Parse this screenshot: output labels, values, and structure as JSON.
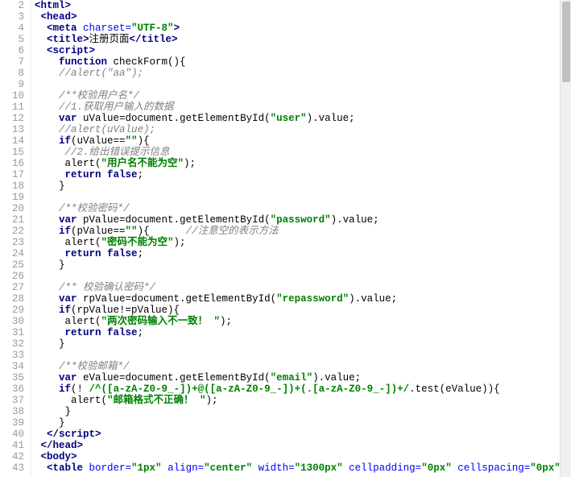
{
  "gutter_start": 2,
  "gutter_end": 43,
  "lines": [
    [
      [
        "tag",
        "<html>"
      ]
    ],
    [
      [
        "plain",
        " "
      ],
      [
        "tag",
        "<head>"
      ]
    ],
    [
      [
        "plain",
        "  "
      ],
      [
        "tag",
        "<meta "
      ],
      [
        "attr",
        "charset="
      ],
      [
        "attrval",
        "\"UTF-8\""
      ],
      [
        "tag",
        ">"
      ]
    ],
    [
      [
        "plain",
        "  "
      ],
      [
        "tag",
        "<title>"
      ],
      [
        "plain",
        "注册页面"
      ],
      [
        "tag",
        "</title>"
      ]
    ],
    [
      [
        "plain",
        "  "
      ],
      [
        "tag",
        "<script>"
      ]
    ],
    [
      [
        "plain",
        "    "
      ],
      [
        "keyword",
        "function"
      ],
      [
        "plain",
        " checkForm(){"
      ]
    ],
    [
      [
        "plain",
        "    "
      ],
      [
        "comment",
        "//alert(\"aa\");"
      ]
    ],
    [
      [
        "plain",
        ""
      ]
    ],
    [
      [
        "plain",
        "    "
      ],
      [
        "comment",
        "/**校验用户名*/"
      ]
    ],
    [
      [
        "plain",
        "    "
      ],
      [
        "comment",
        "//1.获取用户输入的数据"
      ]
    ],
    [
      [
        "plain",
        "    "
      ],
      [
        "keyword",
        "var"
      ],
      [
        "plain",
        " uValue=document.getElementById("
      ],
      [
        "string",
        "\"user\""
      ],
      [
        "plain",
        ").value;"
      ]
    ],
    [
      [
        "plain",
        "    "
      ],
      [
        "comment",
        "//alert(uValue);"
      ]
    ],
    [
      [
        "plain",
        "    "
      ],
      [
        "keyword",
        "if"
      ],
      [
        "plain",
        "(uValue=="
      ],
      [
        "string",
        "\"\""
      ],
      [
        "plain",
        "){"
      ]
    ],
    [
      [
        "plain",
        "     "
      ],
      [
        "comment",
        "//2.给出错误提示信息"
      ]
    ],
    [
      [
        "plain",
        "     alert("
      ],
      [
        "string",
        "\"用户名不能为空\""
      ],
      [
        "plain",
        ");"
      ]
    ],
    [
      [
        "plain",
        "     "
      ],
      [
        "keyword",
        "return"
      ],
      [
        "plain",
        " "
      ],
      [
        "keyword",
        "false"
      ],
      [
        "plain",
        ";"
      ]
    ],
    [
      [
        "plain",
        "    }"
      ]
    ],
    [
      [
        "plain",
        ""
      ]
    ],
    [
      [
        "plain",
        "    "
      ],
      [
        "comment",
        "/**校验密码*/"
      ]
    ],
    [
      [
        "plain",
        "    "
      ],
      [
        "keyword",
        "var"
      ],
      [
        "plain",
        " pValue=document.getElementById("
      ],
      [
        "string",
        "\"password\""
      ],
      [
        "plain",
        ").value;"
      ]
    ],
    [
      [
        "plain",
        "    "
      ],
      [
        "keyword",
        "if"
      ],
      [
        "plain",
        "(pValue=="
      ],
      [
        "string",
        "\"\""
      ],
      [
        "plain",
        "){      "
      ],
      [
        "comment",
        "//注意空的表示方法"
      ]
    ],
    [
      [
        "plain",
        "     alert("
      ],
      [
        "string",
        "\"密码不能为空\""
      ],
      [
        "plain",
        ");"
      ]
    ],
    [
      [
        "plain",
        "     "
      ],
      [
        "keyword",
        "return"
      ],
      [
        "plain",
        " "
      ],
      [
        "keyword",
        "false"
      ],
      [
        "plain",
        ";"
      ]
    ],
    [
      [
        "plain",
        "    }"
      ]
    ],
    [
      [
        "plain",
        ""
      ]
    ],
    [
      [
        "plain",
        "    "
      ],
      [
        "comment",
        "/** 校验确认密码*/"
      ]
    ],
    [
      [
        "plain",
        "    "
      ],
      [
        "keyword",
        "var"
      ],
      [
        "plain",
        " rpValue=document.getElementById("
      ],
      [
        "string",
        "\"repassword\""
      ],
      [
        "plain",
        ").value;"
      ]
    ],
    [
      [
        "plain",
        "    "
      ],
      [
        "keyword",
        "if"
      ],
      [
        "plain",
        "(rpValue!=pValue){"
      ]
    ],
    [
      [
        "plain",
        "     alert("
      ],
      [
        "string",
        "\"两次密码输入不一致！ \""
      ],
      [
        "plain",
        ");"
      ]
    ],
    [
      [
        "plain",
        "     "
      ],
      [
        "keyword",
        "return"
      ],
      [
        "plain",
        " "
      ],
      [
        "keyword",
        "false"
      ],
      [
        "plain",
        ";"
      ]
    ],
    [
      [
        "plain",
        "    }"
      ]
    ],
    [
      [
        "plain",
        ""
      ]
    ],
    [
      [
        "plain",
        "    "
      ],
      [
        "comment",
        "/**校验邮箱*/"
      ]
    ],
    [
      [
        "plain",
        "    "
      ],
      [
        "keyword",
        "var"
      ],
      [
        "plain",
        " eValue=document.getElementById("
      ],
      [
        "string",
        "\"email\""
      ],
      [
        "plain",
        ").value;"
      ]
    ],
    [
      [
        "plain",
        "    "
      ],
      [
        "keyword",
        "if"
      ],
      [
        "plain",
        "(! "
      ],
      [
        "string",
        "/^([a-zA-Z0-9_-])+@([a-zA-Z0-9_-])+(.[a-zA-Z0-9_-])+/"
      ],
      [
        "plain",
        ".test(eValue)){"
      ]
    ],
    [
      [
        "plain",
        "      alert("
      ],
      [
        "string",
        "\"邮箱格式不正确！ \""
      ],
      [
        "plain",
        ");"
      ]
    ],
    [
      [
        "plain",
        "     }"
      ]
    ],
    [
      [
        "plain",
        "    }"
      ]
    ],
    [
      [
        "plain",
        "  "
      ],
      [
        "tag",
        "</script>"
      ]
    ],
    [
      [
        "plain",
        " "
      ],
      [
        "tag",
        "</head>"
      ]
    ],
    [
      [
        "plain",
        " "
      ],
      [
        "tag",
        "<body>"
      ]
    ],
    [
      [
        "plain",
        "  "
      ],
      [
        "tag",
        "<table "
      ],
      [
        "attr",
        "border="
      ],
      [
        "attrval",
        "\"1px\""
      ],
      [
        "plain",
        " "
      ],
      [
        "attr",
        "align="
      ],
      [
        "attrval",
        "\"center\""
      ],
      [
        "plain",
        " "
      ],
      [
        "attr",
        "width="
      ],
      [
        "attrval",
        "\"1300px\""
      ],
      [
        "plain",
        " "
      ],
      [
        "attr",
        "cellpadding="
      ],
      [
        "attrval",
        "\"0px\""
      ],
      [
        "plain",
        " "
      ],
      [
        "attr",
        "cellspacing="
      ],
      [
        "attrval",
        "\"0px\""
      ],
      [
        "tag",
        ">"
      ]
    ]
  ],
  "scrollbar": {
    "visible": true
  }
}
